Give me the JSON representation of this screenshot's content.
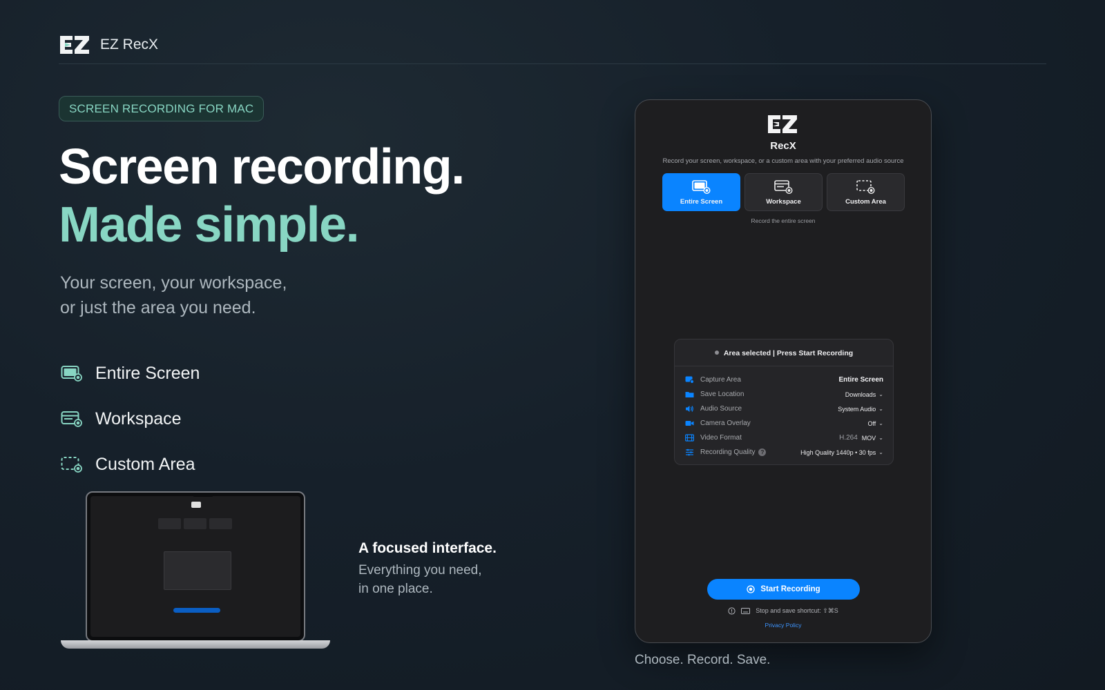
{
  "header": {
    "brand": "EZ RecX",
    "logo_text": "EZ"
  },
  "hero": {
    "pill": "SCREEN RECORDING FOR MAC",
    "headline": "Screen recording.",
    "headline_accent": "Made simple.",
    "sub_line1": "Your screen, your workspace,",
    "sub_line2": "or just the area you need."
  },
  "features": [
    {
      "label": "Entire Screen",
      "icon": "entire-screen-icon"
    },
    {
      "label": "Workspace",
      "icon": "workspace-icon"
    },
    {
      "label": "Custom Area",
      "icon": "custom-area-icon"
    }
  ],
  "focus": {
    "title": "A focused interface.",
    "line1": "Everything you need,",
    "line2": "in one place."
  },
  "app": {
    "logo_text": "EZ",
    "name": "RecX",
    "description": "Record your screen, workspace, or a custom area with your preferred audio source",
    "modes": [
      {
        "label": "Entire Screen",
        "active": true
      },
      {
        "label": "Workspace",
        "active": false
      },
      {
        "label": "Custom Area",
        "active": false
      }
    ],
    "mode_hint": "Record the entire screen",
    "status": "Area selected | Press Start Recording",
    "settings": [
      {
        "key": "Capture Area",
        "value": "Entire Screen"
      },
      {
        "key": "Save Location",
        "value": "Downloads"
      },
      {
        "key": "Audio Source",
        "value": "System Audio"
      },
      {
        "key": "Camera Overlay",
        "value": "Off"
      },
      {
        "key": "Video Format",
        "codec": "H.264",
        "value": "MOV"
      },
      {
        "key": "Recording Quality",
        "value": "High Quality 1440p • 30 fps"
      }
    ],
    "start_label": "Start Recording",
    "shortcut": "Stop and save shortcut: ⇧⌘S",
    "privacy": "Privacy Policy",
    "accent": "#0a84ff"
  },
  "caption": "Choose. Record. Save.",
  "colors": {
    "accent_teal": "#88d6c3",
    "bg": "#16202a"
  }
}
